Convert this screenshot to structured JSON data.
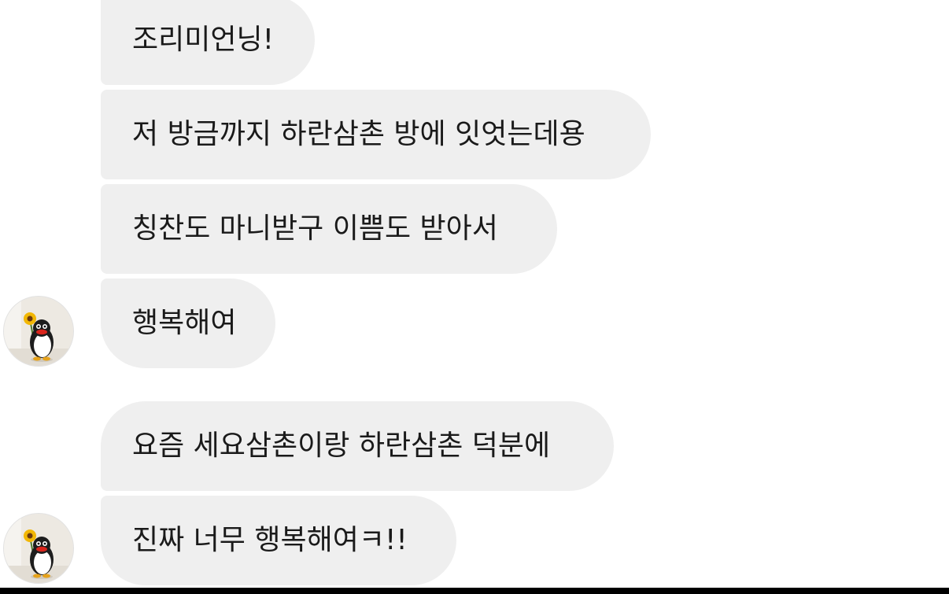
{
  "conversation": {
    "group1": {
      "messages": [
        {
          "text": "조리미언닝!"
        },
        {
          "text": "저 방금까지 하란삼촌 방에 잇엇는데용"
        },
        {
          "text": "칭찬도 마니받구 이쁨도 받아서"
        },
        {
          "text": "행복해여"
        }
      ]
    },
    "group2": {
      "messages": [
        {
          "text": "요즘 세요삼촌이랑 하란삼촌 덕분에"
        },
        {
          "text": "진짜 너무 행복해여ㅋ!!"
        }
      ]
    }
  },
  "avatar": {
    "icon": "penguin-with-sunflower-icon"
  },
  "colors": {
    "bubble_bg": "#efefef",
    "text": "#1a1a1a",
    "background": "#ffffff"
  }
}
